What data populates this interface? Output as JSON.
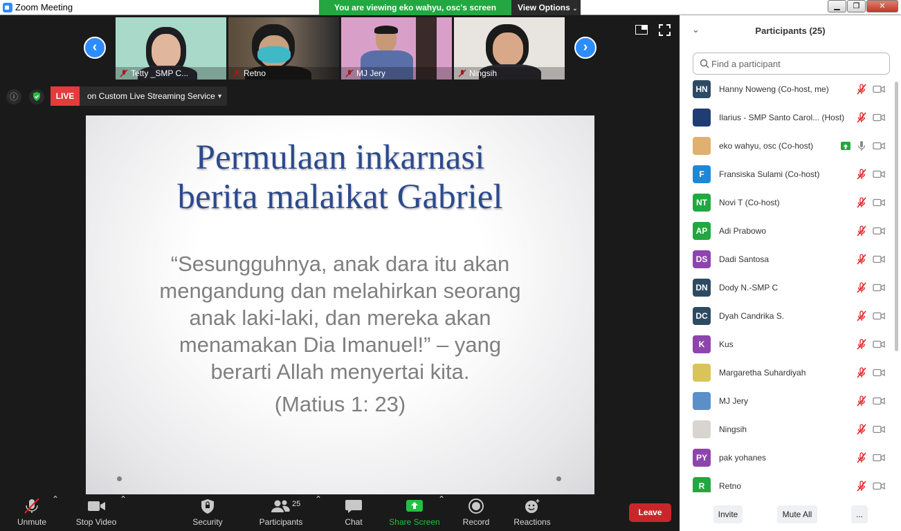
{
  "window": {
    "title": "Zoom Meeting",
    "minimize": "▁",
    "maximize": "❐",
    "close": "✕"
  },
  "banner": {
    "viewing": "You are viewing eko wahyu, osc's screen",
    "view_options": "View Options"
  },
  "thumbnails": [
    {
      "name": "Tetty _SMP C..."
    },
    {
      "name": "Retno"
    },
    {
      "name": "MJ Jery"
    },
    {
      "name": "Ningsih"
    }
  ],
  "status": {
    "live_badge": "LIVE",
    "live_text": "on Custom Live Streaming Service"
  },
  "slide": {
    "title_lines": [
      "Permulaan inkarnasi",
      "berita malaikat Gabriel"
    ],
    "quote_lines": [
      "“Sesungguhnya, anak dara itu akan",
      "mengandung dan melahirkan seorang",
      "anak laki-laki, dan mereka akan",
      "menamakan Dia Imanuel!” – yang",
      "berarti Allah menyertai kita."
    ],
    "reference": "(Matius 1: 23)"
  },
  "toolbar": {
    "unmute": "Unmute",
    "stop_video": "Stop Video",
    "security": "Security",
    "participants": "Participants",
    "participants_count": "25",
    "chat": "Chat",
    "share_screen": "Share Screen",
    "record": "Record",
    "reactions": "Reactions",
    "leave": "Leave"
  },
  "panel": {
    "title": "Participants (25)",
    "search_placeholder": "Find a participant",
    "participants": [
      {
        "initials": "HN",
        "name": "Hanny Noweng (Co-host, me)",
        "color": "#2d4a63"
      },
      {
        "initials": "",
        "name": "Ilarius - SMP Santo Carol... (Host)",
        "color": "#1f3d73"
      },
      {
        "initials": "",
        "name": "eko wahyu, osc (Co-host)",
        "color": "#e0b070"
      },
      {
        "initials": "F",
        "name": "Fransiska Sulami (Co-host)",
        "color": "#1e88d8"
      },
      {
        "initials": "NT",
        "name": "Novi T (Co-host)",
        "color": "#23a741"
      },
      {
        "initials": "AP",
        "name": "Adi Prabowo",
        "color": "#23a741"
      },
      {
        "initials": "DS",
        "name": "Dadi Santosa",
        "color": "#8e44ad"
      },
      {
        "initials": "DN",
        "name": "Dody N.-SMP C",
        "color": "#2d4a63"
      },
      {
        "initials": "DC",
        "name": "Dyah Candrika S.",
        "color": "#2d4a63"
      },
      {
        "initials": "K",
        "name": "Kus",
        "color": "#8e44ad"
      },
      {
        "initials": "",
        "name": "Margaretha Suhardiyah",
        "color": "#d9c45a"
      },
      {
        "initials": "",
        "name": "MJ Jery",
        "color": "#5a8fc9"
      },
      {
        "initials": "",
        "name": "Ningsih",
        "color": "#d8d4d0"
      },
      {
        "initials": "PY",
        "name": "pak yohanes",
        "color": "#8e44ad"
      },
      {
        "initials": "R",
        "name": "Retno",
        "color": "#23a741"
      }
    ],
    "footer": {
      "invite": "Invite",
      "mute_all": "Mute All",
      "more": "..."
    }
  }
}
